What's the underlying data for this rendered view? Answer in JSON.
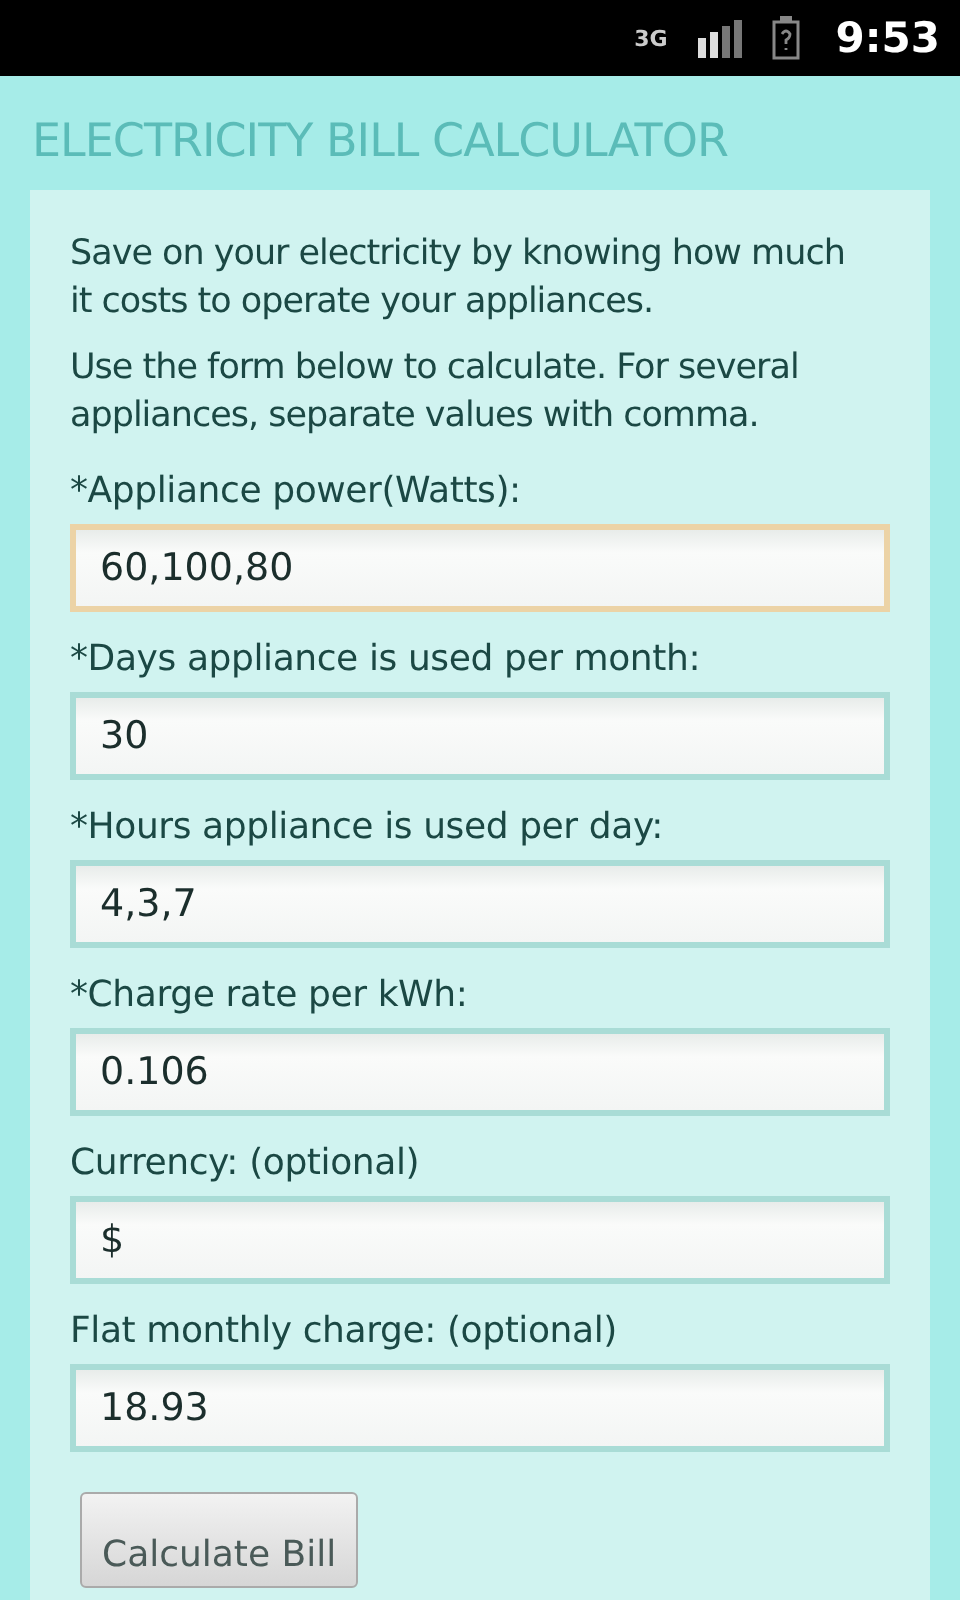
{
  "status_bar": {
    "network": "3G",
    "time": "9:53"
  },
  "title": "ELECTRICITY BILL CALCULATOR",
  "intro": [
    "Save on your electricity by knowing how much it costs to operate your appliances.",
    "Use the form below to calculate. For several appliances, separate values with comma."
  ],
  "fields": [
    {
      "label": "*Appliance power(Watts):",
      "value": "60,100,80",
      "focused": true
    },
    {
      "label": "*Days appliance is used per month:",
      "value": "30",
      "focused": false
    },
    {
      "label": "*Hours appliance is used per day:",
      "value": "4,3,7",
      "focused": false
    },
    {
      "label": "*Charge rate per kWh:",
      "value": "0.106",
      "focused": false
    },
    {
      "label": "Currency: (optional)",
      "value": "$",
      "focused": false
    },
    {
      "label": "Flat monthly charge: (optional)",
      "value": "18.93",
      "focused": false
    }
  ],
  "button": "Calculate Bill"
}
